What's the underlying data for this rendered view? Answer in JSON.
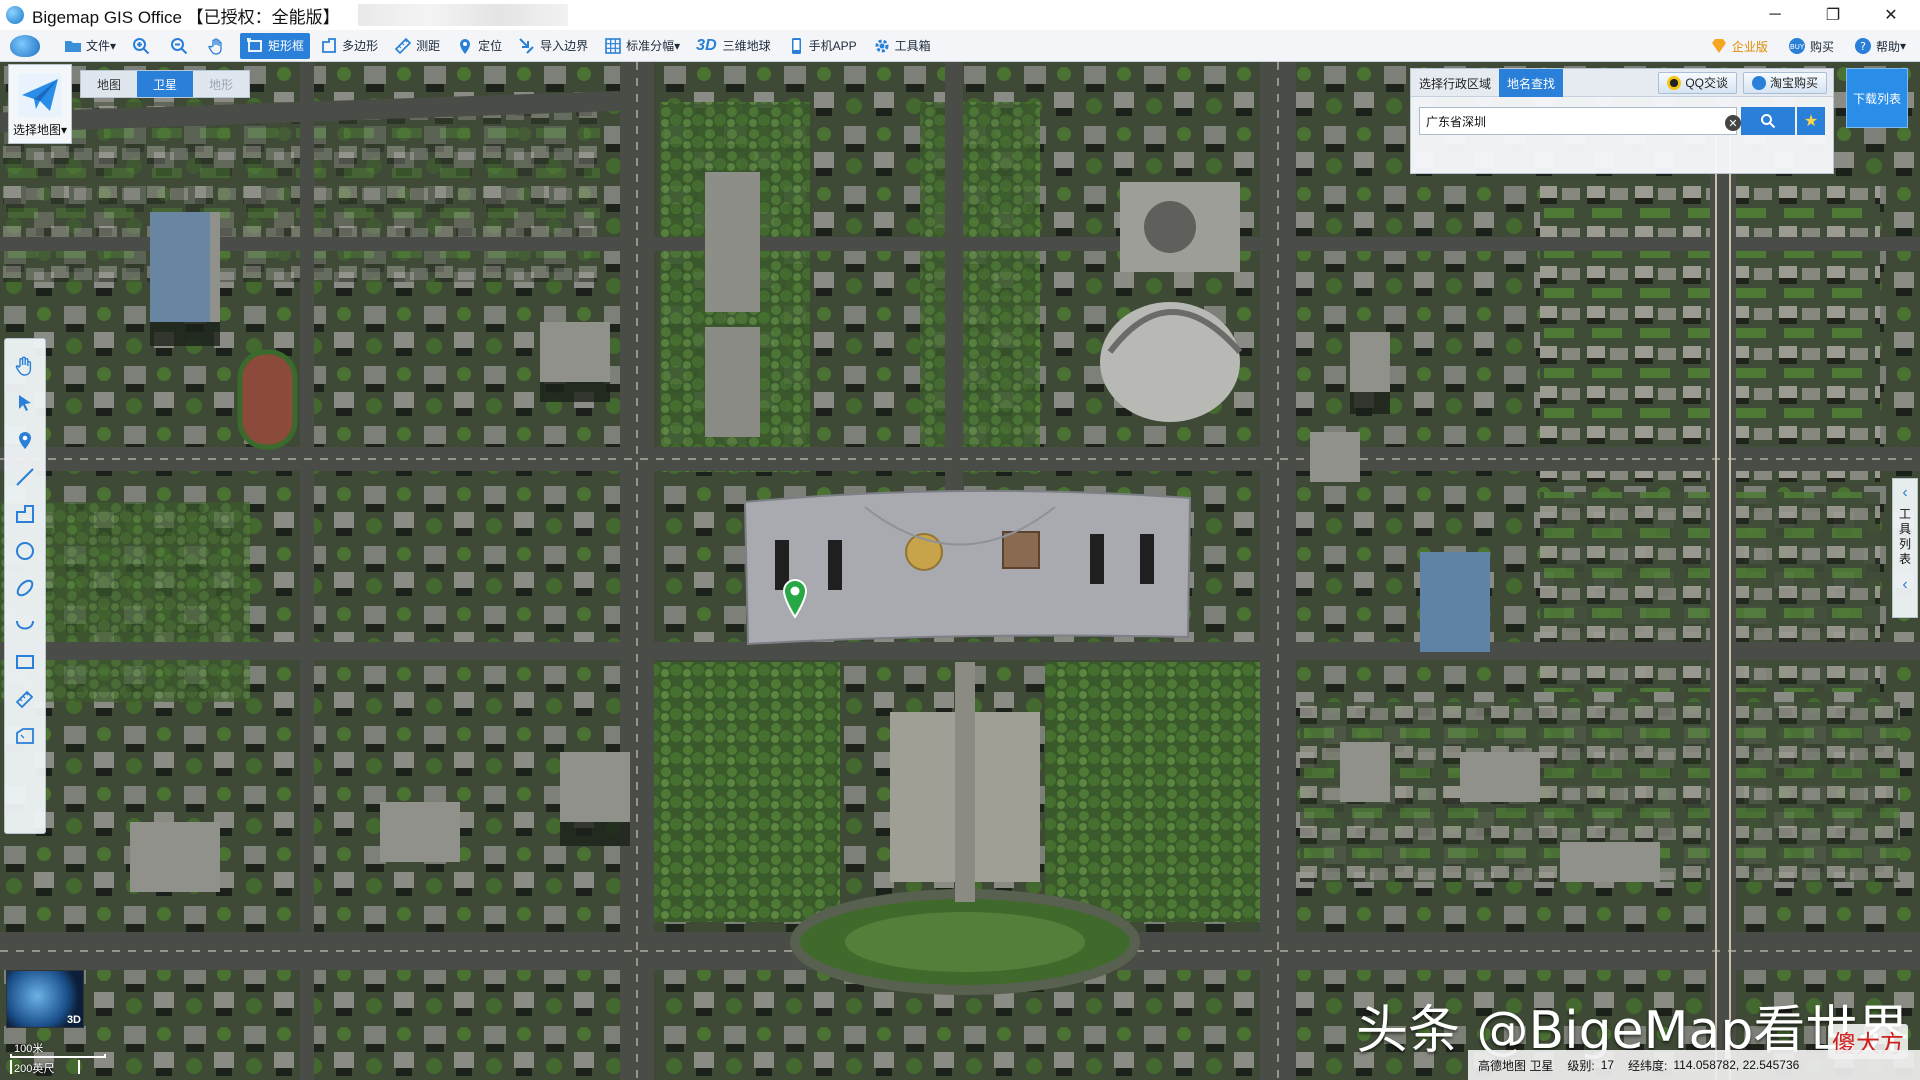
{
  "window": {
    "title": "Bigemap GIS Office 【已授权：全能版】",
    "controls": [
      "─",
      "❐",
      "✕"
    ]
  },
  "toolbar": {
    "items": [
      {
        "label": "文件",
        "dropdown": "▾"
      },
      {
        "label": ""
      },
      {
        "label": ""
      },
      {
        "label": ""
      },
      {
        "label": "矩形框"
      },
      {
        "label": "多边形"
      },
      {
        "label": "测距"
      },
      {
        "label": "定位"
      },
      {
        "label": "导入边界"
      },
      {
        "label": "标准分幅",
        "dropdown": "▾"
      },
      {
        "label": "三维地球",
        "prefix": "3D"
      },
      {
        "label": "手机APP"
      },
      {
        "label": "工具箱"
      }
    ],
    "right_items": [
      {
        "label": "企业版"
      },
      {
        "label": "购买"
      },
      {
        "label": "帮助",
        "dropdown": "▾"
      }
    ]
  },
  "map_panel": {
    "select_map_label": "选择地图",
    "select_map_caret": "▾",
    "map_types": [
      "地图",
      "卫星",
      "地形"
    ],
    "active_map_type": "卫星"
  },
  "search": {
    "tabs": [
      "选择行政区域",
      "地名查找"
    ],
    "active_tab": "地名查找",
    "qq_label": "QQ交谈",
    "taobao_label": "淘宝购买",
    "query_value": "广东省深圳",
    "clear_glyph": "✕",
    "fav_glyph": "★"
  },
  "download_list_label": "下载列表",
  "right_panel": {
    "label_chars": [
      "工",
      "具",
      "列",
      "表"
    ],
    "chevron_top": "‹",
    "chevron_bottom": "‹"
  },
  "globe_label": "3D",
  "scale": {
    "metric": "100米",
    "imperial": "200英尺"
  },
  "watermark": {
    "text": "头条 @BigeMap看世界",
    "corner": "傻大方"
  },
  "status": {
    "source": "高德地图 卫星",
    "level_label": "级别:",
    "level_value": "17",
    "coord_label": "经纬度:",
    "coord_value": "114.058782, 22.545736"
  },
  "colors": {
    "accent": "#2a7fd8",
    "pin": "#27a844"
  }
}
